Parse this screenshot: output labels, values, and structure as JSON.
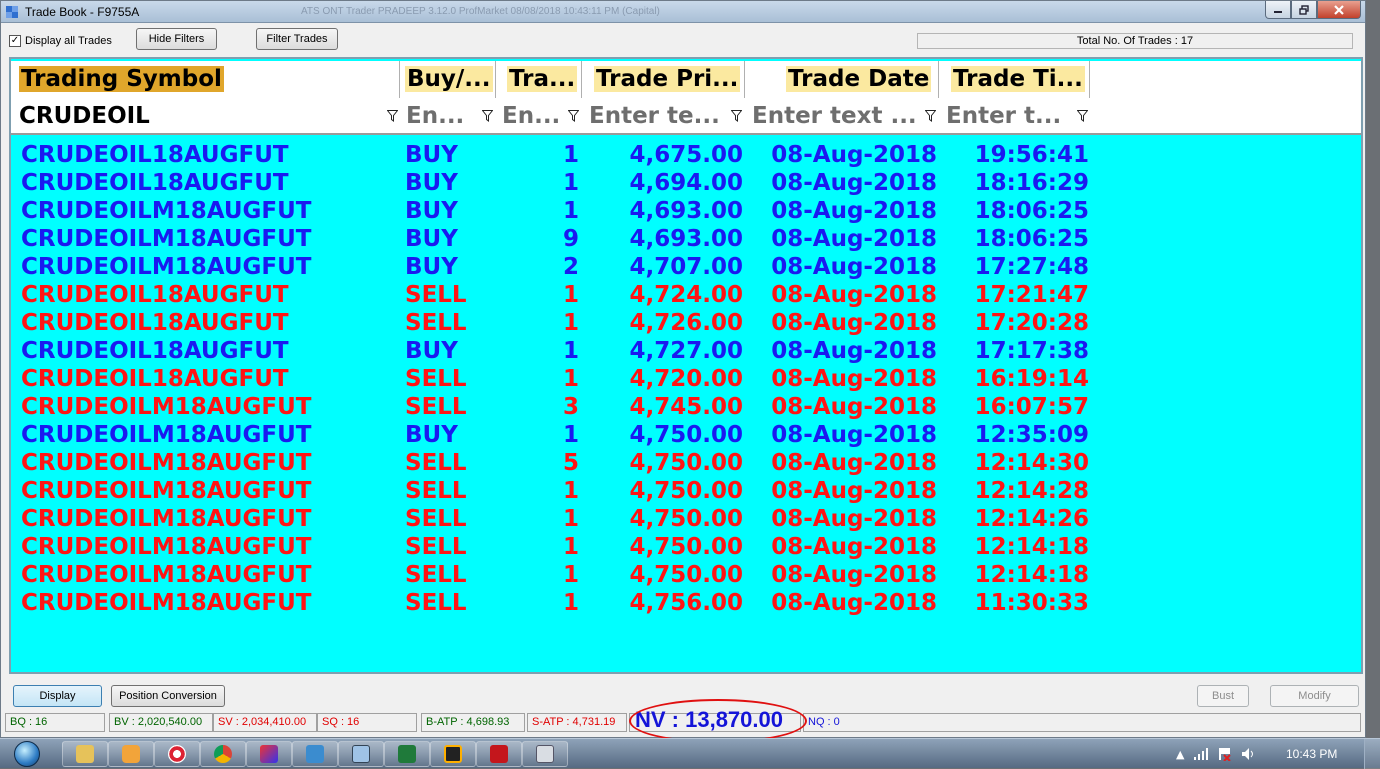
{
  "window": {
    "title": "Trade Book - F9755A",
    "ghost_title": "ATS ONT Trader PRADEEP 3.12.0    ProfMarket 08/08/2018 10:43:11 PM (Capital)"
  },
  "toolbar": {
    "display_all_label": "Display all Trades",
    "display_all_checked": true,
    "hide_filters_label": "Hide Filters",
    "filter_trades_label": "Filter Trades",
    "total_label": "Total No. Of Trades : 17"
  },
  "grid": {
    "headers": [
      "Trading Symbol",
      "Buy/...",
      "Tra...",
      "Trade Pri...",
      "Trade Date",
      "Trade Ti..."
    ],
    "filters": [
      "CRUDEOIL",
      "En...",
      "En...",
      "Enter te...",
      "Enter text ...",
      "Enter t..."
    ],
    "rows": [
      {
        "symbol": "CRUDEOIL18AUGFUT",
        "side": "BUY",
        "qty": "1",
        "price": "4,675.00",
        "date": "08-Aug-2018",
        "time": "19:56:41"
      },
      {
        "symbol": "CRUDEOIL18AUGFUT",
        "side": "BUY",
        "qty": "1",
        "price": "4,694.00",
        "date": "08-Aug-2018",
        "time": "18:16:29"
      },
      {
        "symbol": "CRUDEOILM18AUGFUT",
        "side": "BUY",
        "qty": "1",
        "price": "4,693.00",
        "date": "08-Aug-2018",
        "time": "18:06:25"
      },
      {
        "symbol": "CRUDEOILM18AUGFUT",
        "side": "BUY",
        "qty": "9",
        "price": "4,693.00",
        "date": "08-Aug-2018",
        "time": "18:06:25"
      },
      {
        "symbol": "CRUDEOILM18AUGFUT",
        "side": "BUY",
        "qty": "2",
        "price": "4,707.00",
        "date": "08-Aug-2018",
        "time": "17:27:48"
      },
      {
        "symbol": "CRUDEOIL18AUGFUT",
        "side": "SELL",
        "qty": "1",
        "price": "4,724.00",
        "date": "08-Aug-2018",
        "time": "17:21:47"
      },
      {
        "symbol": "CRUDEOIL18AUGFUT",
        "side": "SELL",
        "qty": "1",
        "price": "4,726.00",
        "date": "08-Aug-2018",
        "time": "17:20:28"
      },
      {
        "symbol": "CRUDEOIL18AUGFUT",
        "side": "BUY",
        "qty": "1",
        "price": "4,727.00",
        "date": "08-Aug-2018",
        "time": "17:17:38"
      },
      {
        "symbol": "CRUDEOIL18AUGFUT",
        "side": "SELL",
        "qty": "1",
        "price": "4,720.00",
        "date": "08-Aug-2018",
        "time": "16:19:14"
      },
      {
        "symbol": "CRUDEOILM18AUGFUT",
        "side": "SELL",
        "qty": "3",
        "price": "4,745.00",
        "date": "08-Aug-2018",
        "time": "16:07:57"
      },
      {
        "symbol": "CRUDEOILM18AUGFUT",
        "side": "BUY",
        "qty": "1",
        "price": "4,750.00",
        "date": "08-Aug-2018",
        "time": "12:35:09"
      },
      {
        "symbol": "CRUDEOILM18AUGFUT",
        "side": "SELL",
        "qty": "5",
        "price": "4,750.00",
        "date": "08-Aug-2018",
        "time": "12:14:30"
      },
      {
        "symbol": "CRUDEOILM18AUGFUT",
        "side": "SELL",
        "qty": "1",
        "price": "4,750.00",
        "date": "08-Aug-2018",
        "time": "12:14:28"
      },
      {
        "symbol": "CRUDEOILM18AUGFUT",
        "side": "SELL",
        "qty": "1",
        "price": "4,750.00",
        "date": "08-Aug-2018",
        "time": "12:14:26"
      },
      {
        "symbol": "CRUDEOILM18AUGFUT",
        "side": "SELL",
        "qty": "1",
        "price": "4,750.00",
        "date": "08-Aug-2018",
        "time": "12:14:18"
      },
      {
        "symbol": "CRUDEOILM18AUGFUT",
        "side": "SELL",
        "qty": "1",
        "price": "4,750.00",
        "date": "08-Aug-2018",
        "time": "12:14:18"
      },
      {
        "symbol": "CRUDEOILM18AUGFUT",
        "side": "SELL",
        "qty": "1",
        "price": "4,756.00",
        "date": "08-Aug-2018",
        "time": "11:30:33"
      }
    ]
  },
  "bottom": {
    "display_label": "Display",
    "position_conversion_label": "Position Conversion",
    "bust_label": "Bust",
    "modify_label": "Modify"
  },
  "status": {
    "bq": "BQ : 16",
    "bv": "BV : 2,020,540.00",
    "sv": "SV : 2,034,410.00",
    "sq": "SQ : 16",
    "batp": "B-ATP : 4,698.93",
    "satp": "S-ATP : 4,731.19",
    "nv": "NV : 13,870.00",
    "nq": "NQ : 0"
  },
  "taskbar": {
    "clock": "10:43 PM"
  },
  "colors": {
    "grid_bg": "#00ffff",
    "buy": "#1a1af0",
    "sell": "#ff1414",
    "header_highlight": "#fbe9a0",
    "first_header_highlight": "#e0a62b"
  }
}
